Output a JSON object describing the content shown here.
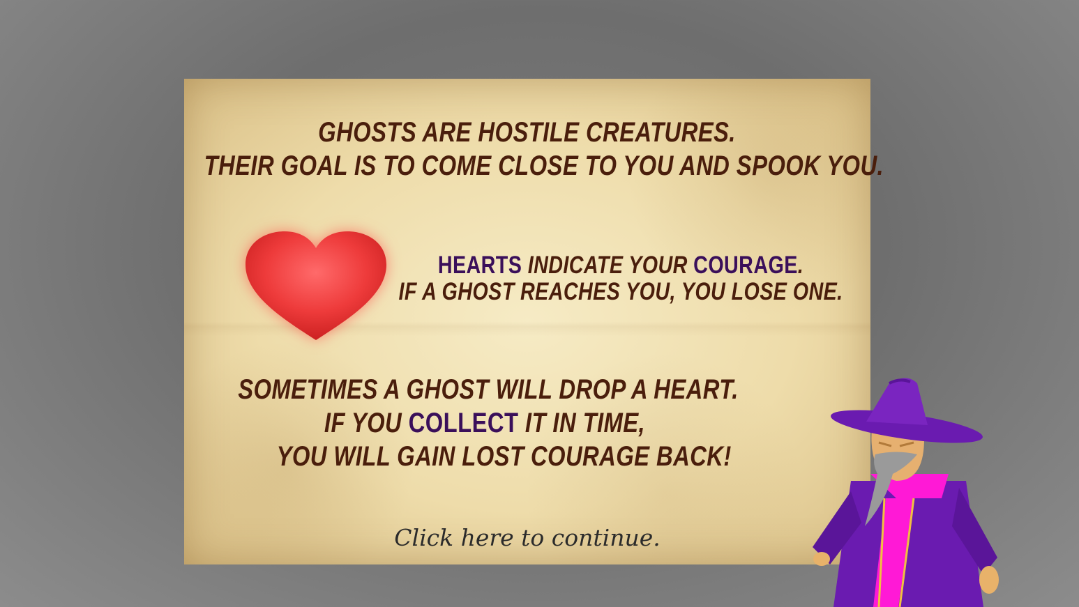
{
  "colors": {
    "text": "#4a1e0c",
    "accent": "#3a0f5a",
    "heart": "#ee3b3b",
    "wizard_robe": "#6a1bb0",
    "wizard_trim": "#ff19d6"
  },
  "intro": {
    "line1": "GHOSTS ARE HOSTILE CREATURES.",
    "line2": "THEIR GOAL IS TO COME CLOSE TO YOU AND SPOOK YOU."
  },
  "hearts_info": {
    "icon": "heart-icon",
    "hearts_word": "HEARTS",
    "indicate_text": " INDICATE YOUR ",
    "courage_word": "COURAGE",
    "period": ".",
    "line2": "IF A GHOST REACHES YOU, YOU LOSE ONE."
  },
  "drop_info": {
    "line1": "SOMETIMES A GHOST WILL DROP A HEART.",
    "line2_pre": "IF YOU ",
    "collect_word": "COLLECT",
    "line2_post": " IT IN TIME,",
    "line3": "YOU WILL GAIN LOST COURAGE BACK!"
  },
  "continue_label": "Click here to continue.",
  "character": "wizard-character"
}
